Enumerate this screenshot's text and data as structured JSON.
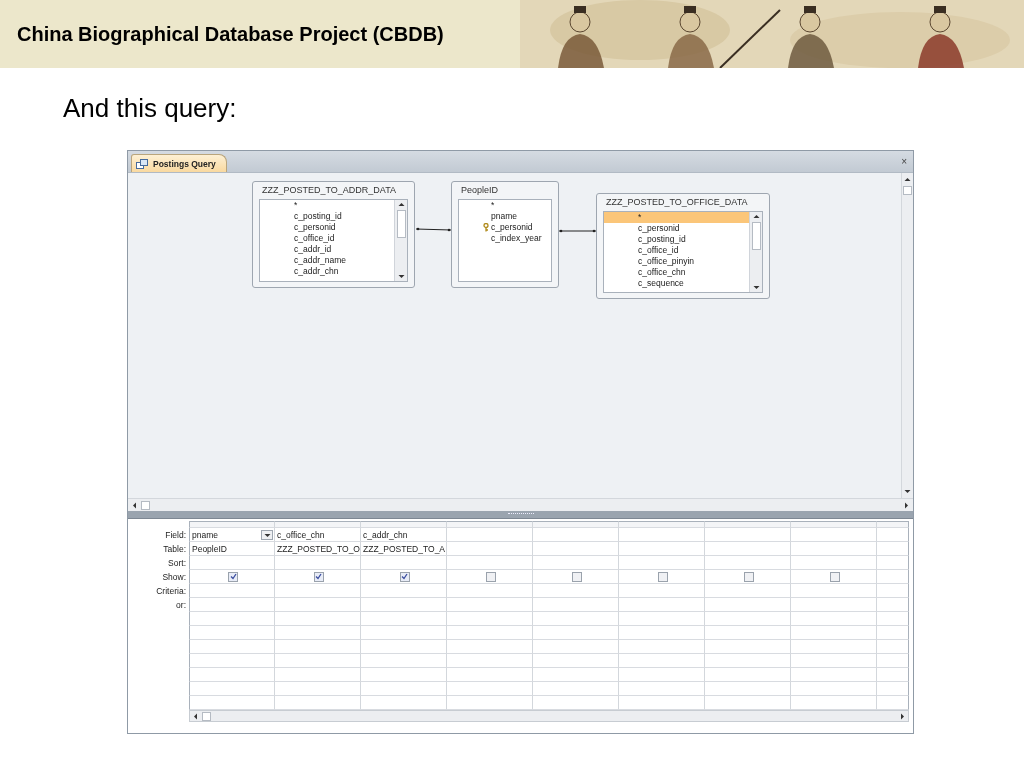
{
  "slide": {
    "header_title": "China Biographical Database Project (CBDB)",
    "heading": "And this query:"
  },
  "window": {
    "tab": {
      "label": "Postings Query",
      "selected": true
    },
    "close_symbol": "×",
    "tables": [
      {
        "name": "ZZZ_POSTED_TO_ADDR_DATA",
        "fields": [
          {
            "name": "*",
            "key": false,
            "selected": false
          },
          {
            "name": "c_posting_id",
            "key": false,
            "selected": false
          },
          {
            "name": "c_personid",
            "key": false,
            "selected": false
          },
          {
            "name": "c_office_id",
            "key": false,
            "selected": false
          },
          {
            "name": "c_addr_id",
            "key": false,
            "selected": false
          },
          {
            "name": "c_addr_name",
            "key": false,
            "selected": false
          },
          {
            "name": "c_addr_chn",
            "key": false,
            "selected": false
          }
        ]
      },
      {
        "name": "PeopleID",
        "fields": [
          {
            "name": "*",
            "key": false,
            "selected": false
          },
          {
            "name": "pname",
            "key": false,
            "selected": false
          },
          {
            "name": "c_personid",
            "key": true,
            "selected": false
          },
          {
            "name": "c_index_year",
            "key": false,
            "selected": false
          }
        ]
      },
      {
        "name": "ZZZ_POSTED_TO_OFFICE_DATA",
        "fields": [
          {
            "name": "*",
            "key": false,
            "selected": true
          },
          {
            "name": "c_personid",
            "key": false,
            "selected": false
          },
          {
            "name": "c_posting_id",
            "key": false,
            "selected": false
          },
          {
            "name": "c_office_id",
            "key": false,
            "selected": false
          },
          {
            "name": "c_office_pinyin",
            "key": false,
            "selected": false
          },
          {
            "name": "c_office_chn",
            "key": false,
            "selected": false
          },
          {
            "name": "c_sequence",
            "key": false,
            "selected": false
          }
        ]
      }
    ],
    "grid": {
      "row_labels": [
        "Field:",
        "Table:",
        "Sort:",
        "Show:",
        "Criteria:",
        "or:"
      ],
      "columns": [
        {
          "field": "pname",
          "table": "PeopleID",
          "show": true,
          "dropdown": true
        },
        {
          "field": "c_office_chn",
          "table": "ZZZ_POSTED_TO_O",
          "show": true,
          "dropdown": false
        },
        {
          "field": "c_addr_chn",
          "table": "ZZZ_POSTED_TO_A",
          "show": true,
          "dropdown": false
        },
        {
          "show": false,
          "dropdown": false
        },
        {
          "show": false,
          "dropdown": false
        },
        {
          "show": false,
          "dropdown": false
        },
        {
          "show": false,
          "dropdown": false
        },
        {
          "show": false,
          "dropdown": false
        }
      ]
    }
  }
}
